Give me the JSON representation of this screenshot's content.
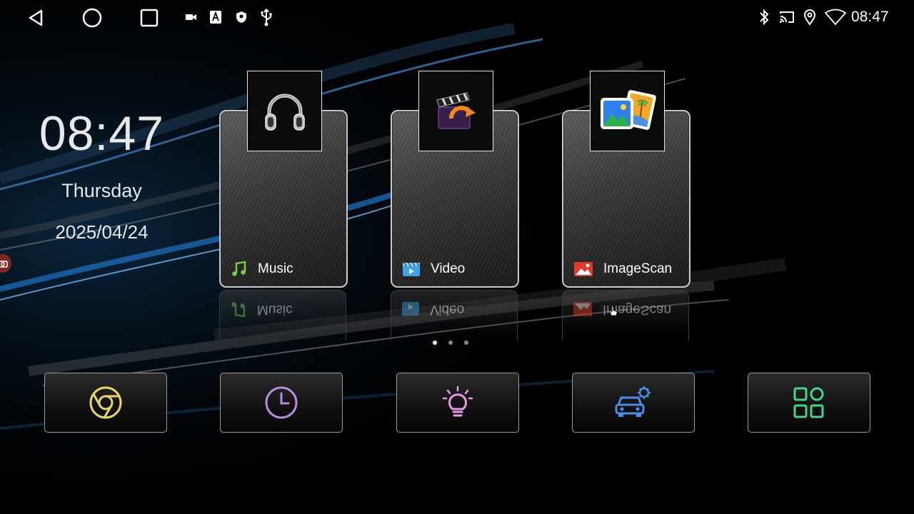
{
  "status_bar": {
    "time": "08:47",
    "nav": [
      "back",
      "home",
      "recents"
    ],
    "left_icons": [
      "camera-icon",
      "font-icon",
      "shield-icon",
      "usb-icon"
    ],
    "right_icons": [
      "bluetooth-icon",
      "cast-icon",
      "location-icon",
      "wifi-icon"
    ]
  },
  "clock": {
    "time": "08:47",
    "day": "Thursday",
    "date": "2025/04/24"
  },
  "apps": [
    {
      "label": "Music",
      "icon": "music-note-icon",
      "thumb": "headphones-icon",
      "accent": "#7bd04a"
    },
    {
      "label": "Video",
      "icon": "video-icon",
      "thumb": "clapperboard-icon",
      "accent": "#3aa6e8"
    },
    {
      "label": "ImageScan",
      "icon": "image-icon",
      "thumb": "photos-icon",
      "accent": "#e23a2a"
    }
  ],
  "pager": {
    "count": 3,
    "active_index": 0
  },
  "dock": [
    {
      "name": "chrome",
      "icon": "chrome-icon",
      "color": "#e8d66a"
    },
    {
      "name": "clock",
      "icon": "clock-icon",
      "color": "#b98ce0"
    },
    {
      "name": "lighting",
      "icon": "lightbulb-icon",
      "color": "#e69ae6"
    },
    {
      "name": "car-settings",
      "icon": "car-settings-icon",
      "color": "#4a8fe8"
    },
    {
      "name": "all-apps",
      "icon": "apps-grid-icon",
      "color": "#4ad48a"
    }
  ]
}
